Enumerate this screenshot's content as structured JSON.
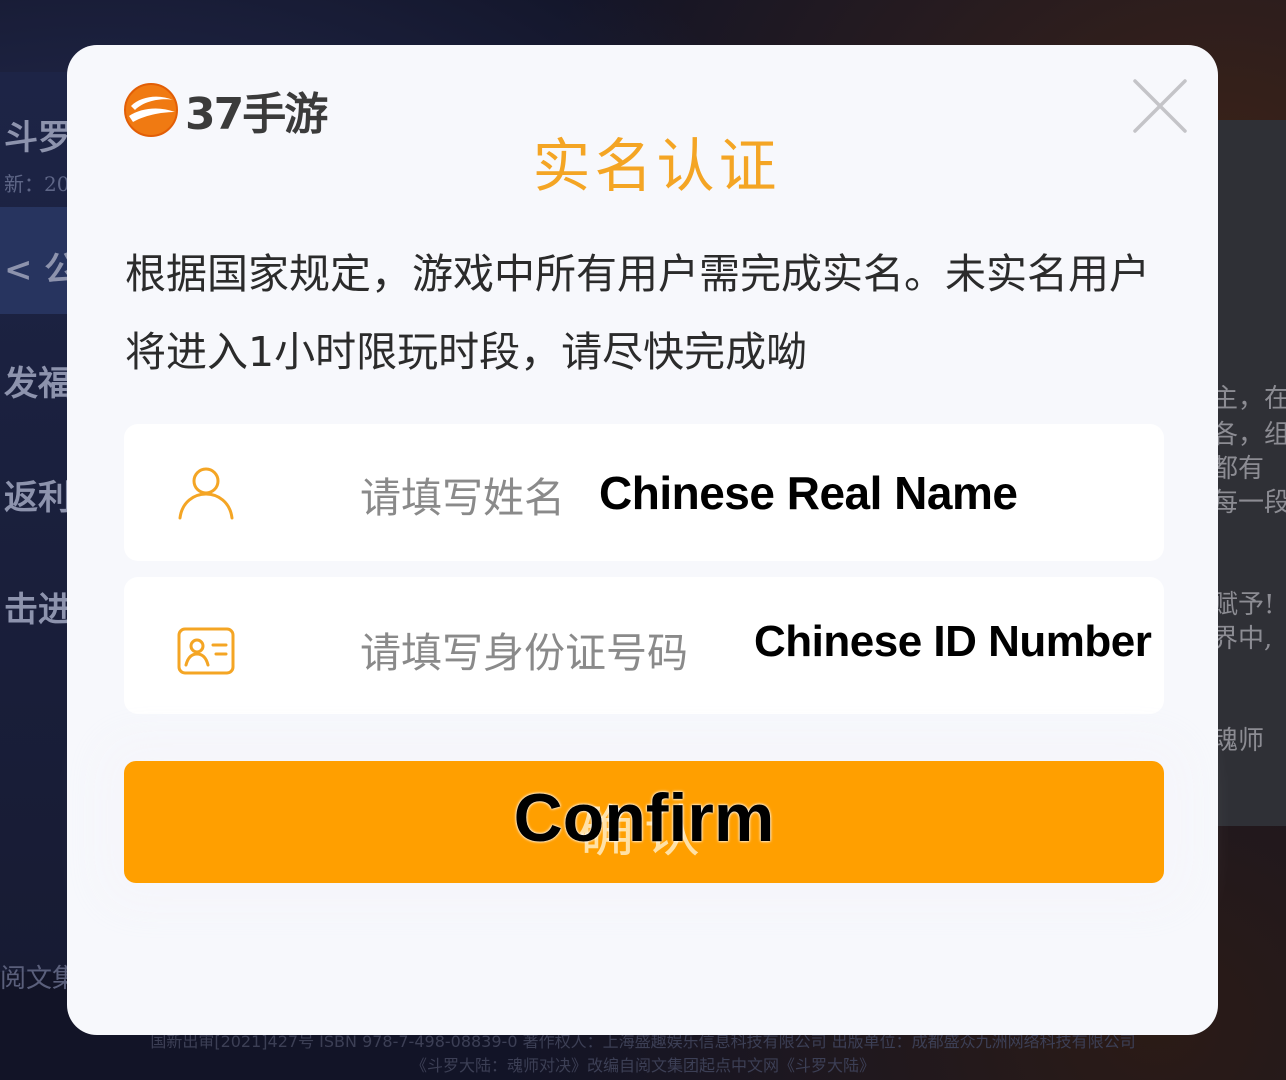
{
  "background": {
    "left_title": "斗罗",
    "left_subtitle": "新：20",
    "left_nav": "< 公",
    "left_items": [
      "发福",
      "返利",
      "击进"
    ],
    "right_lines": [
      "主，在",
      "各，组",
      "都有",
      "每一段",
      "赋予!",
      "界中,",
      "魂师"
    ],
    "footer_left": "阅文集",
    "footer_line1": "国新出审[2021]427号  ISBN 978-7-498-08839-0  著作权人：上海盛趣娱乐信息科技有限公司  出版单位：成都盛众九洲网络科技有限公司",
    "footer_line2": "《斗罗大陆：魂师对决》改编自阅文集团起点中文网《斗罗大陆》"
  },
  "modal": {
    "logo_text": "37手游",
    "title": "实名认证",
    "notice": "根据国家规定，游戏中所有用户需完成实名。未实名用户将进入1小时限玩时段，请尽快完成呦",
    "name_field": {
      "placeholder": "请填写姓名",
      "overlay_label": "Chinese Real Name",
      "icon": "user-icon"
    },
    "id_field": {
      "placeholder": "请填写身份证号码",
      "overlay_label": "Chinese ID Number",
      "icon": "id-card-icon"
    },
    "confirm_button": {
      "label_original": "确认",
      "overlay_label": "Confirm"
    },
    "close_icon": "close-icon"
  },
  "colors": {
    "accent": "#f4a524",
    "button": "#ff9f00",
    "modal_bg": "#f7f8fc",
    "field_bg": "#ffffff",
    "placeholder": "#8a8a8a"
  }
}
